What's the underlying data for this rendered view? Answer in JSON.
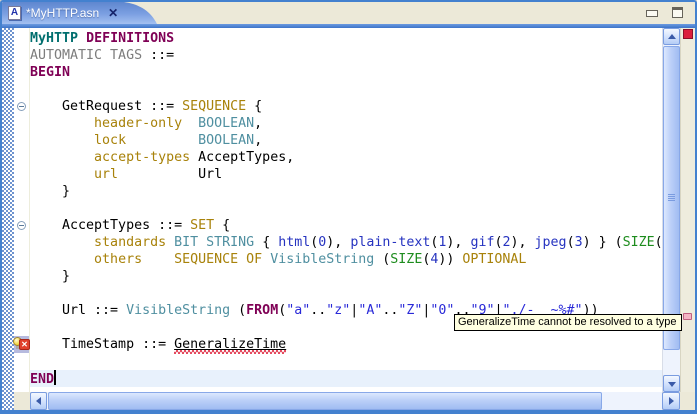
{
  "tab": {
    "title": "*MyHTTP.asn",
    "icon_label": "A",
    "close_glyph": "✕"
  },
  "window_controls": {
    "minimize": "minimize-view",
    "maximize": "maximize-view"
  },
  "tooltip": {
    "text": "GeneralizeTime cannot be resolved to a type"
  },
  "icons": {
    "error_x": "✕",
    "fold": "collapse-minus"
  },
  "colors": {
    "frame_blue": "#4381cf",
    "chrome_beige": "#ece9d8",
    "tab_gradient_top": "#5f87cf",
    "tab_gradient_bottom": "#a3c0f0",
    "current_line": "#e8f1fc",
    "error_overview": "#dc1e3c",
    "problem_marker": "#f4b4c4",
    "marker_range": "#b6bade",
    "keyword": "#7f0055",
    "module_name": "#006e6e",
    "asn_keyword": "#a8820a",
    "field_name": "#a8820a",
    "type_name": "#4f8fa0",
    "string": "#2929d8",
    "enum_value": "#2633c0",
    "size_keyword": "#1d8c1d",
    "gray_text": "#7d7d7d"
  },
  "editor": {
    "lines": [
      {
        "tokens": [
          {
            "t": "MyHTTP",
            "c": "module"
          },
          {
            "t": " ",
            "c": "p"
          },
          {
            "t": "DEFINITIONS",
            "c": "kw"
          }
        ]
      },
      {
        "tokens": [
          {
            "t": "AUTOMATIC TAGS",
            "c": "gray"
          },
          {
            "t": " ::=",
            "c": "p"
          }
        ]
      },
      {
        "tokens": [
          {
            "t": "BEGIN",
            "c": "kw"
          }
        ]
      },
      {
        "tokens": []
      },
      {
        "fold": "collapse-minus",
        "tokens": [
          {
            "t": "    GetRequest ::= ",
            "c": "p"
          },
          {
            "t": "SEQUENCE",
            "c": "asn"
          },
          {
            "t": " {",
            "c": "p"
          }
        ]
      },
      {
        "tokens": [
          {
            "t": "        ",
            "c": "p"
          },
          {
            "t": "header-only",
            "c": "fld"
          },
          {
            "t": "  ",
            "c": "p"
          },
          {
            "t": "BOOLEAN",
            "c": "typ"
          },
          {
            "t": ",",
            "c": "p"
          }
        ]
      },
      {
        "tokens": [
          {
            "t": "        ",
            "c": "p"
          },
          {
            "t": "lock",
            "c": "fld"
          },
          {
            "t": "         ",
            "c": "p"
          },
          {
            "t": "BOOLEAN",
            "c": "typ"
          },
          {
            "t": ",",
            "c": "p"
          }
        ]
      },
      {
        "tokens": [
          {
            "t": "        ",
            "c": "p"
          },
          {
            "t": "accept-types",
            "c": "fld"
          },
          {
            "t": " ",
            "c": "p"
          },
          {
            "t": "AcceptTypes,",
            "c": "p"
          }
        ]
      },
      {
        "tokens": [
          {
            "t": "        ",
            "c": "p"
          },
          {
            "t": "url",
            "c": "fld"
          },
          {
            "t": "          ",
            "c": "p"
          },
          {
            "t": "Url",
            "c": "p"
          }
        ]
      },
      {
        "tokens": [
          {
            "t": "    }",
            "c": "p"
          }
        ]
      },
      {
        "tokens": []
      },
      {
        "fold": "collapse-minus",
        "tokens": [
          {
            "t": "    AcceptTypes ::= ",
            "c": "p"
          },
          {
            "t": "SET",
            "c": "asn"
          },
          {
            "t": " {",
            "c": "p"
          }
        ]
      },
      {
        "tokens": [
          {
            "t": "        ",
            "c": "p"
          },
          {
            "t": "standards",
            "c": "fld"
          },
          {
            "t": " ",
            "c": "p"
          },
          {
            "t": "BIT STRING",
            "c": "typ"
          },
          {
            "t": " { ",
            "c": "p"
          },
          {
            "t": "html",
            "c": "en"
          },
          {
            "t": "(",
            "c": "p"
          },
          {
            "t": "0",
            "c": "en"
          },
          {
            "t": "), ",
            "c": "p"
          },
          {
            "t": "plain-text",
            "c": "en"
          },
          {
            "t": "(",
            "c": "p"
          },
          {
            "t": "1",
            "c": "en"
          },
          {
            "t": "), ",
            "c": "p"
          },
          {
            "t": "gif",
            "c": "en"
          },
          {
            "t": "(",
            "c": "p"
          },
          {
            "t": "2",
            "c": "en"
          },
          {
            "t": "), ",
            "c": "p"
          },
          {
            "t": "jpeg",
            "c": "en"
          },
          {
            "t": "(",
            "c": "p"
          },
          {
            "t": "3",
            "c": "en"
          },
          {
            "t": ")",
            "c": "p"
          },
          {
            "t": " } (",
            "c": "p"
          },
          {
            "t": "SIZE",
            "c": "siz"
          },
          {
            "t": "(",
            "c": "p"
          }
        ]
      },
      {
        "tokens": [
          {
            "t": "        ",
            "c": "p"
          },
          {
            "t": "others",
            "c": "fld"
          },
          {
            "t": "    ",
            "c": "p"
          },
          {
            "t": "SEQUENCE OF",
            "c": "asn"
          },
          {
            "t": " ",
            "c": "p"
          },
          {
            "t": "VisibleString",
            "c": "typ"
          },
          {
            "t": " (",
            "c": "p"
          },
          {
            "t": "SIZE",
            "c": "siz"
          },
          {
            "t": "(",
            "c": "p"
          },
          {
            "t": "4",
            "c": "en"
          },
          {
            "t": ")) ",
            "c": "p"
          },
          {
            "t": "OPTIONAL",
            "c": "asn"
          }
        ]
      },
      {
        "tokens": [
          {
            "t": "    }",
            "c": "p"
          }
        ]
      },
      {
        "tokens": []
      },
      {
        "tokens": [
          {
            "t": "    Url ::= ",
            "c": "p"
          },
          {
            "t": "VisibleString",
            "c": "typ"
          },
          {
            "t": " (",
            "c": "p"
          },
          {
            "t": "FROM",
            "c": "kw"
          },
          {
            "t": "(",
            "c": "p"
          },
          {
            "t": "\"a\"",
            "c": "str"
          },
          {
            "t": "..",
            "c": "p"
          },
          {
            "t": "\"z\"",
            "c": "str"
          },
          {
            "t": "|",
            "c": "p"
          },
          {
            "t": "\"A\"",
            "c": "str"
          },
          {
            "t": "..",
            "c": "p"
          },
          {
            "t": "\"Z\"",
            "c": "str"
          },
          {
            "t": "|",
            "c": "p"
          },
          {
            "t": "\"0\"",
            "c": "str"
          },
          {
            "t": "..",
            "c": "p"
          },
          {
            "t": "\"9\"",
            "c": "str"
          },
          {
            "t": "|",
            "c": "p"
          },
          {
            "t": "\"./-_ ~%#\"",
            "c": "str"
          },
          {
            "t": "))",
            "c": "p"
          }
        ]
      },
      {
        "tokens": []
      },
      {
        "marker": "error-quickfix",
        "tokens": [
          {
            "t": "    TimeStamp ::= ",
            "c": "p"
          },
          {
            "t": "GeneralizeTime",
            "c": "err"
          }
        ]
      },
      {
        "tokens": []
      },
      {
        "highlight": true,
        "caret": true,
        "tokens": [
          {
            "t": "END",
            "c": "kw"
          }
        ]
      }
    ]
  }
}
